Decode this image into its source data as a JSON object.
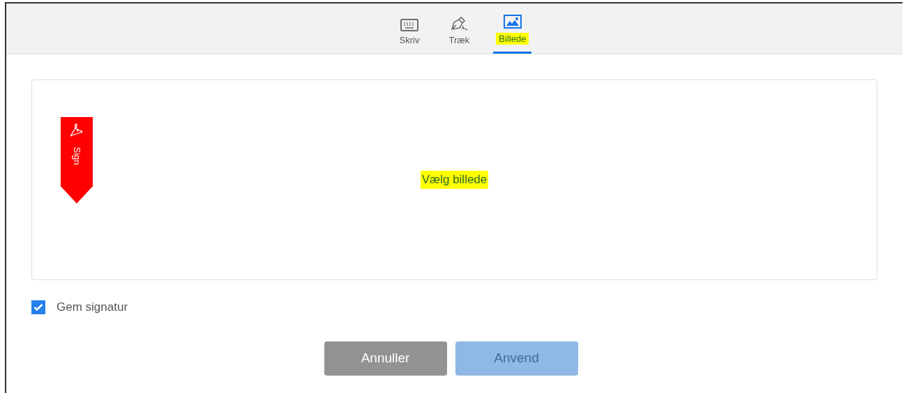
{
  "tabs": [
    {
      "kind": "keyboard",
      "label": "Skriv",
      "selected": false
    },
    {
      "kind": "pen",
      "label": "Træk",
      "selected": false
    },
    {
      "kind": "image",
      "label": "Billede",
      "selected": true
    }
  ],
  "drop_zone": {
    "badge": "Sign",
    "prompt": "Vælg billede"
  },
  "save_signature": {
    "label": "Gem signatur",
    "checked": true
  },
  "buttons": [
    {
      "label": "Annuller",
      "kind": "cancel",
      "disabled": false
    },
    {
      "label": "Anvend",
      "kind": "apply",
      "disabled": true
    }
  ]
}
